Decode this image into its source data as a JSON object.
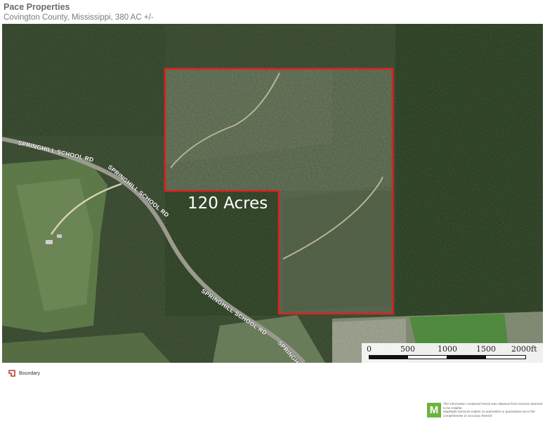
{
  "header": {
    "title": "Pace Properties",
    "subtitle": "Covington County, Mississippi, 380 AC +/-"
  },
  "map": {
    "parcel_label": "120 Acres",
    "boundary_color": "#e02020",
    "road_labels": [
      "SPRINGHILL SCHOOL RD",
      "SPRINGHILL SCHOOL RD",
      "SPRINGHILL SCHOOL RD",
      "SPRINGHI"
    ],
    "scale": {
      "ticks": [
        "0",
        "500",
        "1000",
        "1500",
        "2000ft"
      ]
    }
  },
  "legend": {
    "items": [
      {
        "label": "Boundary",
        "icon": "boundary-icon",
        "color": "#c0392b"
      }
    ]
  },
  "footer": {
    "logo_letter": "M",
    "logo_color": "#6db33f",
    "disclaimer_line1": "The information contained herein was obtained from sources deemed to be reliable.",
    "disclaimer_line2": "MapRight Services makes no warranties or guarantees as to the completeness or accuracy thereof."
  }
}
